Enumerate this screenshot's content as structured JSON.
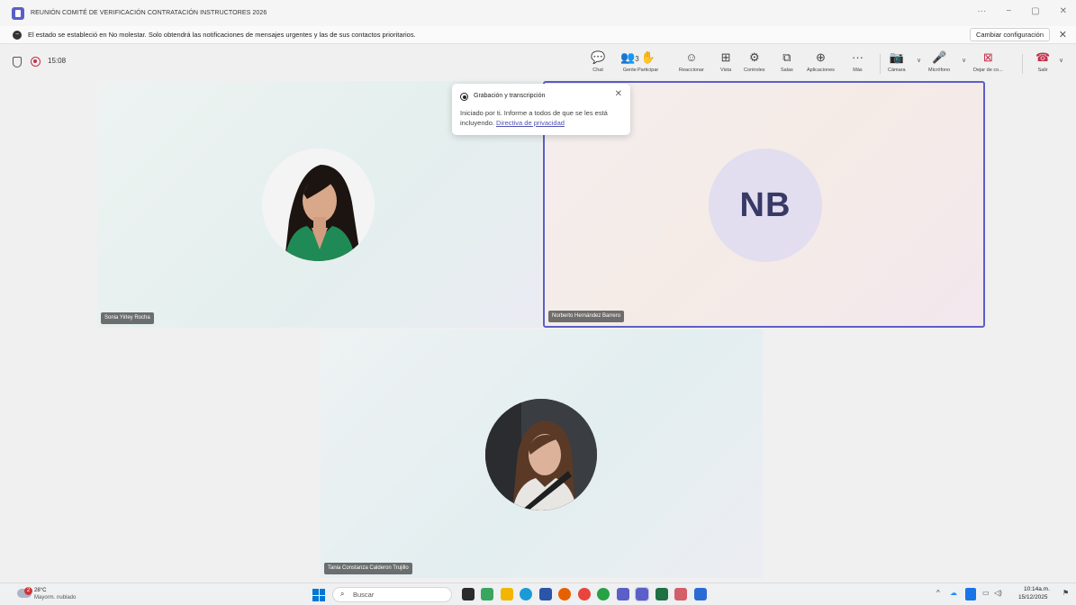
{
  "window": {
    "title": "REUNIÓN COMITÉ DE VERIFICACIÓN CONTRATACIÓN INSTRUCTORES 2026",
    "controls": [
      "···",
      "−",
      "▢",
      "✕"
    ]
  },
  "notification": {
    "text": "El estado se estableció en No molestar. Solo obtendrá las notificaciones de mensajes urgentes y las de sus contactos prioritarios.",
    "button": "Cambiar configuración"
  },
  "meeting": {
    "timer": "15:08",
    "toolbar": {
      "chat": "Chat",
      "people": "Gente",
      "people_count": "3",
      "raise": "Participar",
      "react": "Reaccionar",
      "view": "Vista",
      "controls": "Controles",
      "rooms": "Salas",
      "apps": "Aplicaciones",
      "more": "Más",
      "camera": "Cámara",
      "mic": "Micrófono",
      "share": "Dejar de co...",
      "leave": "Salir"
    }
  },
  "participants": [
    {
      "name": "Sonia Yirley Rocha"
    },
    {
      "name": "Norberto Hernández Barrero",
      "initials": "NB"
    },
    {
      "name": "Tania Constanza Calderon Trujillo"
    }
  ],
  "popup": {
    "title": "Grabación y transcripción",
    "body": "Iniciado por ti. Informe a todos de que se les está incluyendo.",
    "link": "Directiva de privacidad"
  },
  "taskbar": {
    "weather_temp": "28°C",
    "weather_desc": "Mayorm. nublado",
    "weather_badge": "2",
    "search": "Buscar",
    "time": "10:14a.m.",
    "date": "15/12/2025"
  },
  "colors": {
    "accent": "#5b5fc7",
    "record": "#c4314b",
    "leave": "#c4314b"
  }
}
